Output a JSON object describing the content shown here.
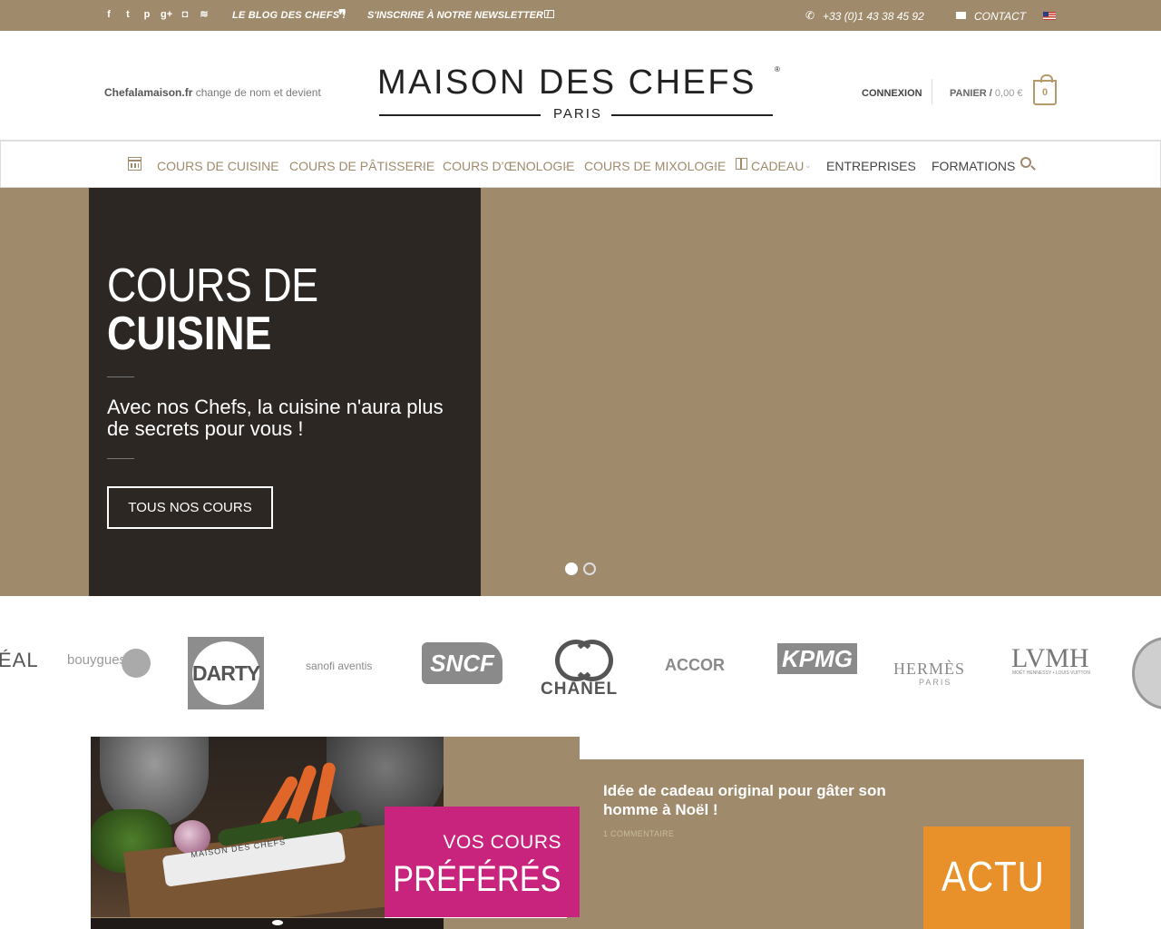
{
  "topbar": {
    "social_icons": [
      "facebook-icon",
      "twitter-icon",
      "pinterest-icon",
      "google-plus-icon",
      "instagram-icon",
      "rss-icon"
    ],
    "social_glyphs": [
      "f",
      "t",
      "p",
      "g+",
      "◘",
      "≋"
    ],
    "blog_link": "LE BLOG DES CHEFS !",
    "quote_glyph": "❞",
    "newsletter_link": "S'INSCRIRE À NOTRE NEWSLETTER !",
    "phone_glyph": "✆",
    "phone": "+33 (0)1 43 38 45 92",
    "contact": "CONTACT",
    "language_flag": "us-flag-icon"
  },
  "header": {
    "tagline_domain": "Chefalamaison.fr",
    "tagline_text": " change de nom et devient",
    "logo_brand": "MAISON DES CHEFS",
    "logo_reg": "®",
    "logo_city": "PARIS",
    "login": "CONNEXION",
    "cart_label": "PANIER /",
    "cart_amount": " 0,00 €",
    "cart_count": "0"
  },
  "nav": {
    "items": [
      {
        "label": "COURS DE CUISINE",
        "has_dropdown": true
      },
      {
        "label": "COURS DE PÂTISSERIE",
        "has_dropdown": true
      },
      {
        "label": "COURS D’ŒNOLOGIE",
        "has_dropdown": true
      },
      {
        "label": "COURS DE MIXOLOGIE",
        "has_dropdown": true
      },
      {
        "label": "CADEAU",
        "has_dropdown": true
      },
      {
        "label": "ENTREPRISES",
        "has_dropdown": true
      },
      {
        "label": "FORMATIONS",
        "has_dropdown": false
      }
    ],
    "chevron": "⌄"
  },
  "hero": {
    "title_line1": "COURS DE",
    "title_line2": "CUISINE",
    "subtitle": "Avec nos Chefs, la cuisine n'aura plus de secrets pour vous !",
    "button": "TOUS NOS COURS",
    "slides_total": 2,
    "slide_active": 1
  },
  "client_logos": {
    "oreal": "ÉAL",
    "bouygues": "bouygues",
    "darty": "DARTY",
    "sanofi": "sanofi aventis",
    "sncf": "SNCF",
    "chanel": "CHANEL",
    "accor": "ACCOR",
    "kpmg": "KPMG",
    "hermes": "HERMÈS",
    "hermes_city": "PARIS",
    "lvmh": "LVMH",
    "lvmh_sub": "MOËT HENNESSY • LOUIS VUITTON"
  },
  "promo": {
    "photo_towel_text": "MAISON DES CHEFS",
    "line1": "VOS COURS",
    "line2": "PRÉFÉRÉS"
  },
  "blog_card": {
    "title": "Idée de cadeau original pour gâter son homme à Noël !",
    "comments": "1 COMMENTAIRE",
    "badge": "ACTU"
  },
  "colors": {
    "brand_tan": "#9f8b6c",
    "dark_panel": "#2d2723",
    "promo_pink": "#c8237d",
    "actu_orange": "#e8912a"
  }
}
